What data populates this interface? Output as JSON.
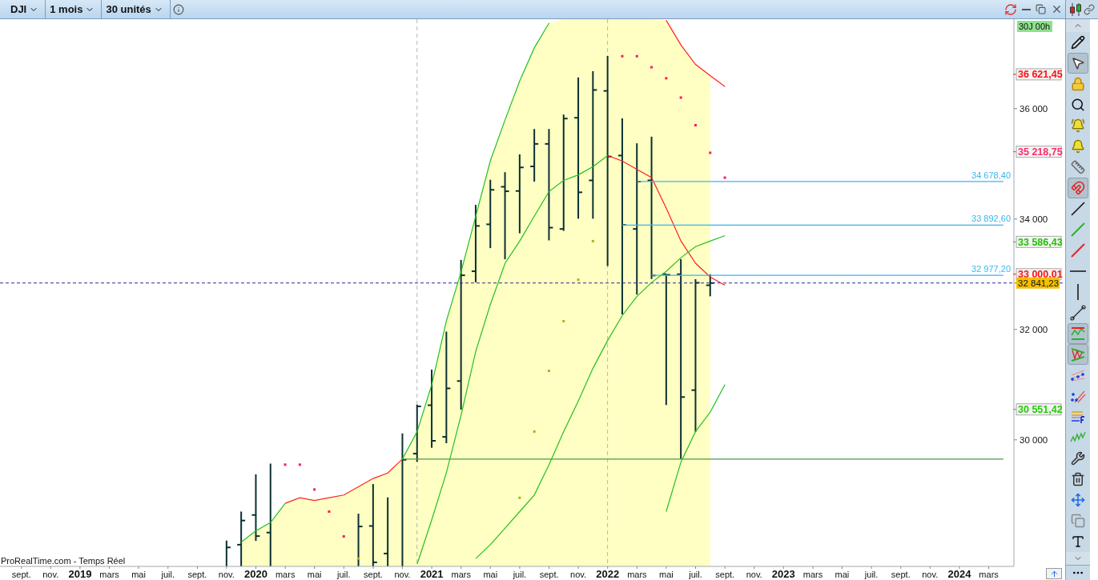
{
  "toolbar": {
    "instrument": "DJI",
    "period": "1 mois",
    "units": "30 unités"
  },
  "chart": {
    "footer": "ProRealTime.com - Temps Réel",
    "timer_badge": "30J 00h",
    "chart_data": {
      "type": "line",
      "x": [
        2019.917,
        2020,
        2020.083,
        2020.167,
        2020.25,
        2020.333,
        2020.417,
        2020.5,
        2020.583,
        2020.667,
        2020.75,
        2020.833,
        2020.917,
        2021,
        2021.083,
        2021.167,
        2021.25,
        2021.333,
        2021.417,
        2021.5,
        2021.583,
        2021.667,
        2021.75,
        2021.833,
        2021.917,
        2022,
        2022.083,
        2022.167,
        2022.25,
        2022.333,
        2022.417,
        2022.5,
        2022.583,
        2022.667,
        2022.75,
        2022.833,
        2022.917,
        2023,
        2023.083,
        2023.167,
        2023.25,
        2023.333,
        2023.417,
        2023.5,
        2023.583,
        2023.667,
        2023.75,
        2023.833,
        2023.917,
        2024,
        2024.083,
        2024.167,
        2024.25
      ],
      "xlim": [
        2018.545,
        2024.31
      ],
      "ylim": [
        27707,
        37620
      ],
      "yticks": [
        {
          "value": 30000,
          "label": "30 000"
        },
        {
          "value": 32000,
          "label": "32 000"
        },
        {
          "value": 34000,
          "label": "34 000"
        },
        {
          "value": 36000,
          "label": "36 000"
        }
      ],
      "xticks": [
        {
          "value": 2018.667,
          "label": "sept."
        },
        {
          "value": 2018.833,
          "label": "nov."
        },
        {
          "value": 2019,
          "label": "2019"
        },
        {
          "value": 2019.167,
          "label": "mars"
        },
        {
          "value": 2019.333,
          "label": "mai"
        },
        {
          "value": 2019.5,
          "label": "juil."
        },
        {
          "value": 2019.667,
          "label": "sept."
        },
        {
          "value": 2019.833,
          "label": "nov."
        },
        {
          "value": 2020,
          "label": "2020"
        },
        {
          "value": 2020.167,
          "label": "mars"
        },
        {
          "value": 2020.333,
          "label": "mai"
        },
        {
          "value": 2020.5,
          "label": "juil."
        },
        {
          "value": 2020.667,
          "label": "sept."
        },
        {
          "value": 2020.833,
          "label": "nov."
        },
        {
          "value": 2021,
          "label": "2021"
        },
        {
          "value": 2021.167,
          "label": "mars"
        },
        {
          "value": 2021.333,
          "label": "mai"
        },
        {
          "value": 2021.5,
          "label": "juil."
        },
        {
          "value": 2021.667,
          "label": "sept."
        },
        {
          "value": 2021.833,
          "label": "nov."
        },
        {
          "value": 2022,
          "label": "2022"
        },
        {
          "value": 2022.167,
          "label": "mars"
        },
        {
          "value": 2022.333,
          "label": "mai"
        },
        {
          "value": 2022.5,
          "label": "juil."
        },
        {
          "value": 2022.667,
          "label": "sept."
        },
        {
          "value": 2022.833,
          "label": "nov."
        },
        {
          "value": 2023,
          "label": "2023"
        },
        {
          "value": 2023.167,
          "label": "mars"
        },
        {
          "value": 2023.333,
          "label": "mai"
        },
        {
          "value": 2023.5,
          "label": "juil."
        },
        {
          "value": 2023.667,
          "label": "sept."
        },
        {
          "value": 2023.833,
          "label": "nov."
        },
        {
          "value": 2024,
          "label": "2024"
        },
        {
          "value": 2024.167,
          "label": "mars"
        }
      ],
      "series": [
        {
          "color": "#22c022",
          "values": [
            28150,
            28350,
            28500,
            28850,
            null,
            null,
            null,
            null,
            null,
            null,
            null,
            null,
            null,
            null,
            null,
            null,
            null,
            null,
            null,
            null,
            null,
            null,
            null,
            null,
            null,
            null,
            null,
            null,
            null,
            null,
            null,
            null,
            null,
            null,
            null,
            null,
            null,
            null,
            null,
            null,
            null,
            null,
            null,
            null,
            null,
            null,
            null,
            null,
            null,
            null,
            null,
            null,
            null
          ]
        },
        {
          "color": "#ff2020",
          "values": [
            null,
            null,
            null,
            28850,
            28950,
            28900,
            28950,
            29000,
            29150,
            29300,
            29400,
            29650,
            null,
            null,
            null,
            null,
            null,
            null,
            null,
            null,
            null,
            null,
            null,
            null,
            null,
            null,
            null,
            null,
            null,
            null,
            null,
            null,
            null,
            null,
            null,
            null,
            null,
            null,
            null,
            null,
            null,
            null,
            null,
            null,
            null,
            null,
            null,
            null,
            null,
            null,
            null,
            null,
            null
          ]
        },
        {
          "color": "#22c022",
          "values": [
            null,
            null,
            null,
            null,
            null,
            null,
            null,
            null,
            null,
            null,
            null,
            29650,
            30150,
            31000,
            32150,
            33050,
            34050,
            35050,
            35800,
            36500,
            37100,
            37550,
            null,
            null,
            null,
            null,
            null,
            null,
            null,
            null,
            null,
            null,
            null,
            null,
            null,
            null,
            null,
            null,
            null,
            null,
            null,
            null,
            null,
            null,
            null,
            null,
            null,
            null,
            null,
            null,
            null,
            null,
            null
          ]
        },
        {
          "color": "#ff2020",
          "values": [
            null,
            null,
            null,
            null,
            null,
            null,
            null,
            null,
            null,
            null,
            null,
            null,
            null,
            null,
            null,
            null,
            null,
            null,
            null,
            null,
            null,
            null,
            null,
            null,
            null,
            null,
            null,
            null,
            null,
            37600,
            37150,
            36800,
            36600,
            36400,
            null,
            null,
            null,
            null,
            null,
            null,
            null,
            null,
            null,
            null,
            null,
            null,
            null,
            null,
            null,
            null,
            null,
            null,
            null
          ]
        },
        {
          "color": "#22c022",
          "values": [
            null,
            null,
            null,
            null,
            null,
            null,
            null,
            null,
            null,
            null,
            null,
            null,
            27750,
            28550,
            29400,
            30450,
            31600,
            32450,
            33200,
            33600,
            34050,
            34500,
            34700,
            34800,
            34950,
            35150,
            null,
            null,
            null,
            null,
            null,
            null,
            null,
            null,
            null,
            null,
            null,
            null,
            null,
            null,
            null,
            null,
            null,
            null,
            null,
            null,
            null,
            null,
            null,
            null,
            null,
            null,
            null
          ]
        },
        {
          "color": "#ff2020",
          "values": [
            null,
            null,
            null,
            null,
            null,
            null,
            null,
            null,
            null,
            null,
            null,
            null,
            null,
            null,
            null,
            null,
            null,
            null,
            null,
            null,
            null,
            null,
            null,
            null,
            null,
            35150,
            35050,
            34900,
            34750,
            34200,
            33600,
            33200,
            32950,
            32800,
            null,
            null,
            null,
            null,
            null,
            null,
            null,
            null,
            null,
            null,
            null,
            null,
            null,
            null,
            null,
            null,
            null,
            null,
            null
          ]
        },
        {
          "color": "#22c022",
          "values": [
            null,
            null,
            null,
            null,
            null,
            null,
            null,
            null,
            null,
            null,
            null,
            null,
            null,
            null,
            null,
            null,
            27850,
            28100,
            28400,
            28700,
            29000,
            29550,
            30150,
            30700,
            31300,
            31800,
            32250,
            32600,
            32850,
            33050,
            33300,
            33500,
            33600,
            33700,
            null,
            null,
            null,
            null,
            null,
            null,
            null,
            null,
            null,
            null,
            null,
            null,
            null,
            null,
            null,
            null,
            null,
            null,
            null
          ]
        },
        {
          "color": "#22c022",
          "values": [
            null,
            null,
            null,
            null,
            null,
            null,
            null,
            null,
            null,
            null,
            null,
            null,
            null,
            null,
            null,
            null,
            null,
            null,
            null,
            null,
            null,
            null,
            null,
            null,
            null,
            null,
            null,
            null,
            null,
            28700,
            29600,
            30150,
            30500,
            31000,
            null,
            null,
            null,
            null,
            null,
            null,
            null,
            null,
            null,
            null,
            null,
            null,
            null,
            null,
            null,
            null,
            null,
            null,
            null
          ]
        },
        {
          "color": "#4a9a4a",
          "values": [
            null,
            null,
            null,
            null,
            null,
            null,
            null,
            null,
            null,
            null,
            null,
            29650,
            29650,
            29650,
            29650,
            29650,
            29650,
            29650,
            29650,
            29650,
            29650,
            29650,
            29650,
            29650,
            29650,
            29650,
            29650,
            29650,
            29650,
            29650,
            29650,
            29650,
            29650,
            29650,
            29650,
            29650,
            29650,
            29650,
            29650,
            29650,
            29650,
            29650,
            29650,
            29650,
            29650,
            29650,
            29650,
            29650,
            29650,
            29650,
            29650,
            29650,
            29650
          ]
        },
        {
          "name": "34 678,40",
          "color": "#3ab4f0",
          "values": [
            null,
            null,
            null,
            null,
            null,
            null,
            null,
            null,
            null,
            null,
            null,
            null,
            null,
            null,
            null,
            null,
            null,
            null,
            null,
            null,
            null,
            null,
            null,
            null,
            null,
            null,
            null,
            34680,
            34680,
            34680,
            34680,
            34680,
            34680,
            34680,
            34680,
            34680,
            34680,
            34680,
            34680,
            34680,
            34680,
            34680,
            34680,
            34680,
            34680,
            34680,
            34680,
            34680,
            34680,
            34680,
            34680,
            34680,
            34680
          ]
        },
        {
          "name": "33 892,60",
          "color": "#3ab4f0",
          "values": [
            null,
            null,
            null,
            null,
            null,
            null,
            null,
            null,
            null,
            null,
            null,
            null,
            null,
            null,
            null,
            null,
            null,
            null,
            null,
            null,
            null,
            null,
            null,
            null,
            null,
            null,
            33890,
            33890,
            33890,
            33890,
            33890,
            33890,
            33890,
            33890,
            33890,
            33890,
            33890,
            33890,
            33890,
            33890,
            33890,
            33890,
            33890,
            33890,
            33890,
            33890,
            33890,
            33890,
            33890,
            33890,
            33890,
            33890,
            33890
          ]
        },
        {
          "name": "32 977,20",
          "color": "#3ab4f0",
          "values": [
            null,
            null,
            null,
            null,
            null,
            null,
            null,
            null,
            null,
            null,
            null,
            null,
            null,
            null,
            null,
            null,
            null,
            null,
            null,
            null,
            null,
            null,
            null,
            null,
            null,
            null,
            null,
            null,
            32980,
            32980,
            32980,
            32980,
            32980,
            32980,
            32980,
            32980,
            32980,
            32980,
            32980,
            32980,
            32980,
            32980,
            32980,
            32980,
            32980,
            32980,
            32980,
            32980,
            32980,
            32980,
            32980,
            32980,
            32980
          ]
        }
      ]
    }
  },
  "price_tags": [
    {
      "label": "36 621,45",
      "color": "#ff1010",
      "kind": "indicator"
    },
    {
      "label": "35 218,75",
      "color": "#ff2a6a",
      "kind": "indicator"
    },
    {
      "label": "33 586,43",
      "color": "#22c000",
      "kind": "indicator"
    },
    {
      "label": "33 000,01",
      "color": "#ff1010",
      "kind": "indicator"
    },
    {
      "label": "32 841,23",
      "color": "#f5c000",
      "kind": "price"
    },
    {
      "label": "30 551,42",
      "color": "#22cc00",
      "kind": "indicator"
    }
  ],
  "tools": [
    {
      "kind": "pencil",
      "selected": false
    },
    {
      "kind": "pointer",
      "selected": true
    },
    {
      "kind": "pointer-lock",
      "selected": false
    },
    {
      "kind": "zoom",
      "selected": false
    },
    {
      "kind": "alarm",
      "selected": false
    },
    {
      "kind": "alarm-cursor",
      "selected": false
    },
    {
      "kind": "ruler",
      "selected": false
    },
    {
      "kind": "magnet",
      "selected": true
    },
    {
      "kind": "line",
      "selected": false
    },
    {
      "kind": "line-up",
      "selected": false
    },
    {
      "kind": "line-down",
      "selected": false
    },
    {
      "kind": "hline",
      "selected": false
    },
    {
      "kind": "vline",
      "selected": false
    },
    {
      "kind": "segment",
      "selected": false
    },
    {
      "kind": "channel",
      "selected": true
    },
    {
      "kind": "triangle",
      "selected": true
    },
    {
      "kind": "fan",
      "selected": false
    },
    {
      "kind": "parallel",
      "selected": false
    },
    {
      "kind": "fibo",
      "selected": false
    },
    {
      "kind": "wave",
      "selected": false
    },
    {
      "kind": "tools",
      "selected": false
    },
    {
      "kind": "trash",
      "selected": false
    },
    {
      "kind": "move",
      "selected": false
    },
    {
      "kind": "copy",
      "selected": false
    },
    {
      "kind": "text",
      "selected": false
    }
  ]
}
